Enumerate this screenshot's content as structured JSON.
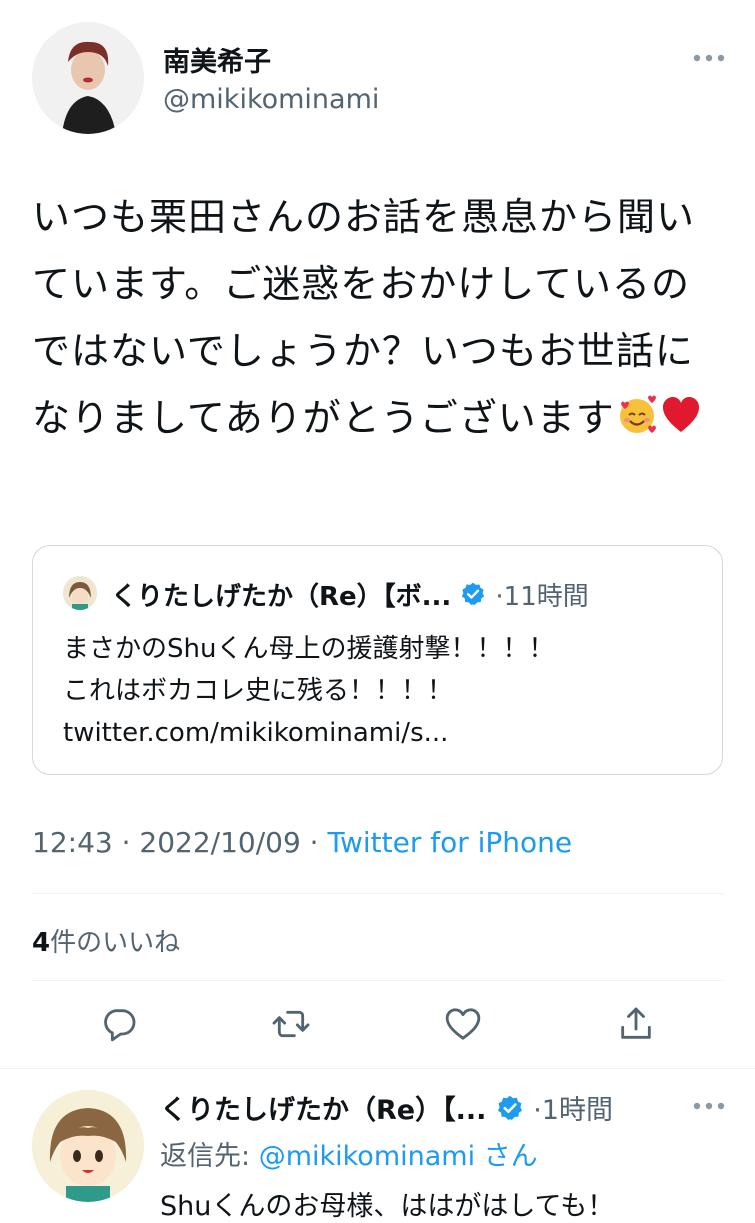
{
  "tweet": {
    "display_name": "南美希子",
    "handle": "@mikikominami",
    "text": "いつも栗田さんのお話を愚息から聞いています。ご迷惑をおかけしているのではないでしょうか？いつもお世話になりましてありがとうございます",
    "emojis": [
      "smiling-face-with-hearts",
      "red-heart"
    ],
    "timestamp": "12:43 · 2022/10/09 · ",
    "source": "Twitter for iPhone",
    "likes_count": "4",
    "likes_label": "件のいいね"
  },
  "quote": {
    "display_name": "くりたしげたか（Re）【ボ...",
    "time": "·11時間",
    "lines": [
      "まさかのShuくん母上の援護射撃！！！！",
      "これはボカコレ史に残る！！！！",
      "twitter.com/mikikominami/s..."
    ]
  },
  "reply": {
    "display_name": "くりたしげたか（Re）【...",
    "time": "·1時間",
    "reply_to_prefix": "返信先: ",
    "reply_to_mention": "@mikikominami",
    "reply_to_suffix": " さん",
    "partial_text": "Shuくんのお母様、ははがはしても！"
  },
  "icons": {
    "more": "more-dots-icon",
    "verified": "verified-badge-icon",
    "reply": "reply-icon",
    "retweet": "retweet-icon",
    "like": "heart-icon",
    "share": "share-icon"
  },
  "colors": {
    "accent": "#1d9bf0",
    "secondary_text": "#536471",
    "primary_text": "#0f1419",
    "border": "#cfd9de"
  }
}
